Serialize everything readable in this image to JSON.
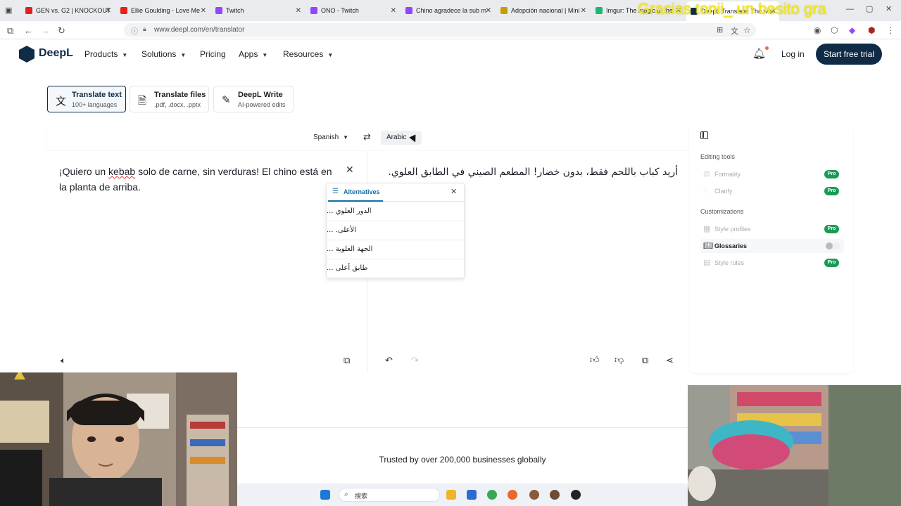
{
  "browser": {
    "tabs": [
      {
        "title": "GEN vs. G2 | KNOCKOUT",
        "color": "#e62117"
      },
      {
        "title": "Ellie Goulding - Love Me",
        "color": "#e62117"
      },
      {
        "title": "Twitch",
        "color": "#9146ff"
      },
      {
        "title": "ONO - Twitch",
        "color": "#9146ff"
      },
      {
        "title": "Chino agradece la sub m",
        "color": "#9146ff"
      },
      {
        "title": "Adopción nacional | Mini",
        "color": "#c89b00"
      },
      {
        "title": "Imgur: The magic of the",
        "color": "#1bb76e"
      },
      {
        "title": "DeepL Translate: The wo",
        "color": "#0f2b46"
      }
    ],
    "overlay_text": "Gracias tonii_ un besito gra",
    "url": "www.deepl.com/en/translator"
  },
  "header": {
    "logo_text": "DeepL",
    "nav": [
      {
        "label": "Products",
        "dropdown": true
      },
      {
        "label": "Solutions",
        "dropdown": true
      },
      {
        "label": "Pricing",
        "dropdown": false
      },
      {
        "label": "Apps",
        "dropdown": true
      },
      {
        "label": "Resources",
        "dropdown": true
      }
    ],
    "login": "Log in",
    "cta": "Start free trial"
  },
  "modes": [
    {
      "title": "Translate text",
      "subtitle": "100+ languages",
      "icon": "translate-icon"
    },
    {
      "title": "Translate files",
      "subtitle": ".pdf, .docx, .pptx",
      "icon": "file-icon"
    },
    {
      "title": "DeepL Write",
      "subtitle": "AI-powered edits",
      "icon": "pen-icon"
    }
  ],
  "translator": {
    "source_lang": "Spanish",
    "target_lang": "Arabic",
    "source_text_parts": [
      "¡Quiero un ",
      "kebab",
      " solo de carne, sin verduras! El chino está en la planta de arriba."
    ],
    "target_text": "أريد كباب باللحم فقط، بدون خضار! المطعم الصيني في الطابق العلوي."
  },
  "alternatives": {
    "title": "Alternatives",
    "items": [
      "الدور العلوي ...",
      "الأعلى. ...",
      "الجهة العلوية ...",
      "طابق أعلى ..."
    ]
  },
  "side_panel": {
    "editing_tools_heading": "Editing tools",
    "editing_tools": [
      {
        "label": "Formality",
        "badge": "Pro"
      },
      {
        "label": "Clarify",
        "badge": "Pro"
      }
    ],
    "customizations_heading": "Customizations",
    "customizations": [
      {
        "label": "Style profiles",
        "badge": "Pro"
      },
      {
        "label": "Glossaries",
        "badge": ""
      },
      {
        "label": "Style rules",
        "badge": "Pro"
      }
    ]
  },
  "footer": {
    "trusted": "Trusted by over 200,000 businesses globally"
  },
  "taskbar": {
    "search_placeholder": "搜索"
  },
  "colors": {
    "brand": "#0f2b46",
    "pro_badge": "#1a9a57",
    "alt_accent": "#0f6fa8"
  }
}
